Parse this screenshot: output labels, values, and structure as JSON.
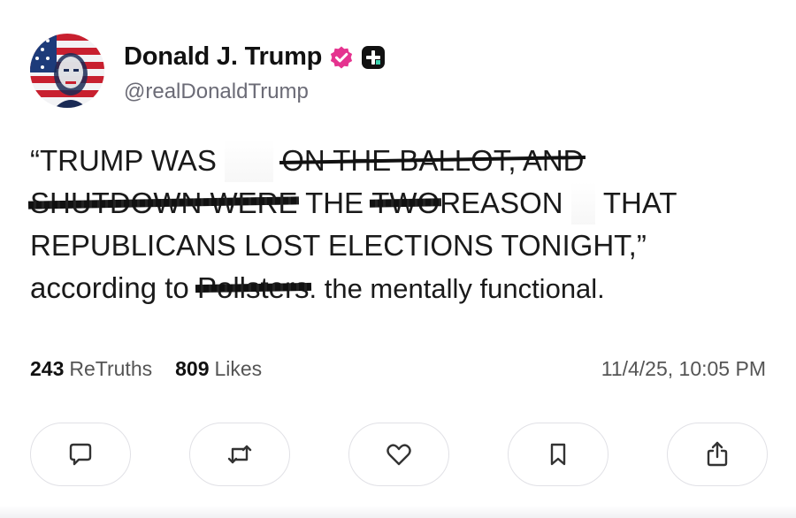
{
  "author": {
    "display_name": "Donald J. Trump",
    "handle": "@realDonaldTrump",
    "avatar_icon": "flag-portrait-avatar",
    "verified_icon": "verified-badge-icon",
    "verified_color": "#e5338f",
    "plus_icon": "truth-plus-icon"
  },
  "post": {
    "line1_prefix": "“TRUMP WAS",
    "line1_struck": "ON THE BALLOT, AND",
    "line2_struck": "SHUTDOWN WERE",
    "line2_mid": "THE",
    "line2_struck2": "TWO",
    "line2_end": "REASON",
    "line2_end2": "THAT",
    "line3": "REPUBLICANS LOST ELECTIONS TONIGHT,”",
    "line4_prefix": "according to",
    "line4_struck": "Pollsters",
    "line4_suffix": ". the mentally functional."
  },
  "stats": {
    "retruths_count": "243",
    "retruths_label": "ReTruths",
    "likes_count": "809",
    "likes_label": "Likes",
    "timestamp": "11/4/25, 10:05 PM"
  },
  "actions": [
    {
      "icon": "reply-icon"
    },
    {
      "icon": "retruth-icon"
    },
    {
      "icon": "like-heart-icon"
    },
    {
      "icon": "bookmark-icon"
    },
    {
      "icon": "share-icon"
    }
  ],
  "colors": {
    "text": "#111111",
    "muted": "#6b6b76",
    "border": "#e1e1e6"
  }
}
